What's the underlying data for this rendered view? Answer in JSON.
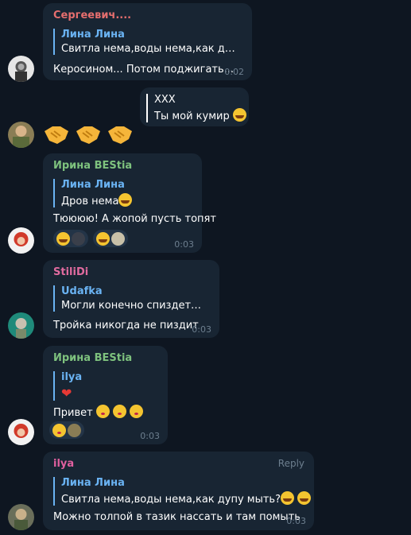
{
  "messages": [
    {
      "sender": "Сергеевич....",
      "reply_name": "Лина Лина",
      "reply_text": "Свитла нема,воды нема,как дупу м...",
      "text": "Керосином... Потом поджигать...",
      "time": "0:02"
    },
    {
      "reply_name": "XXX",
      "reply_text": "Ты мой кумир"
    },
    {
      "sender": "Ирина BEStia",
      "reply_name": "Лина Лина",
      "reply_text": "Дров нема",
      "text": "Тюююю! А жопой пусть топят",
      "time": "0:03"
    },
    {
      "sender": "StiliDi",
      "reply_name": "Udafka",
      "reply_text": "Могли конечно спиздеть, та...",
      "text": "Тройка никогда не пиздит",
      "time": "0:03"
    },
    {
      "sender": "Ирина BEStia",
      "reply_name": "ilya",
      "text": "Привет",
      "time": "0:03"
    },
    {
      "sender": "ilya",
      "reply_label": "Reply",
      "reply_name": "Лина Лина",
      "reply_text": "Свитла нема,воды нема,как дупу мыть?",
      "text": "Можно толпой в тазик нассать и там помыть",
      "time": "0:03"
    }
  ],
  "colors": {
    "background": "#0e1621",
    "bubble": "#182533",
    "bubble_out": "#2b5278",
    "sender_red": "#e56e6e",
    "sender_green": "#7ec27e",
    "sender_pink": "#e06b9f",
    "sender_ilya": "#e0609f",
    "link": "#6ab3f3"
  }
}
